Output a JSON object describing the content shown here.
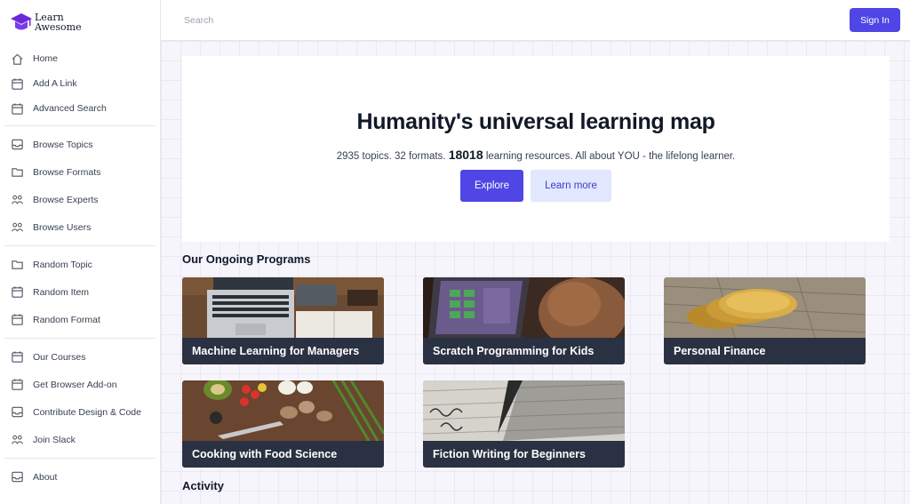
{
  "brand": {
    "line1": "Learn",
    "line2": "Awesome"
  },
  "search": {
    "placeholder": "Search"
  },
  "auth": {
    "sign_in": "Sign In"
  },
  "sidebar": {
    "groups": [
      [
        {
          "label": "Home",
          "icon": "home-icon"
        },
        {
          "label": "Add A Link",
          "icon": "calendar-icon"
        },
        {
          "label": "Advanced Search",
          "icon": "calendar-icon"
        }
      ],
      [
        {
          "label": "Browse Topics",
          "icon": "inbox-icon"
        },
        {
          "label": "Browse Formats",
          "icon": "folder-icon"
        },
        {
          "label": "Browse Experts",
          "icon": "users-icon"
        },
        {
          "label": "Browse Users",
          "icon": "users-icon"
        }
      ],
      [
        {
          "label": "Random Topic",
          "icon": "folder-icon"
        },
        {
          "label": "Random Item",
          "icon": "calendar-icon"
        },
        {
          "label": "Random Format",
          "icon": "calendar-icon"
        }
      ],
      [
        {
          "label": "Our Courses",
          "icon": "calendar-icon"
        },
        {
          "label": "Get Browser Add-on",
          "icon": "calendar-icon"
        },
        {
          "label": "Contribute Design & Code",
          "icon": "inbox-icon"
        },
        {
          "label": "Join Slack",
          "icon": "users-icon"
        }
      ],
      [
        {
          "label": "About",
          "icon": "inbox-icon"
        }
      ]
    ]
  },
  "hero": {
    "title": "Humanity's universal learning map",
    "sub_prefix": "2935 topics. 32 formats.",
    "resources_count": "18018",
    "sub_suffix": "learning resources. All about YOU - the lifelong learner.",
    "explore_label": "Explore",
    "learn_more_label": "Learn more"
  },
  "programs": {
    "title": "Our Ongoing Programs",
    "items": [
      {
        "label": "Machine Learning for Managers",
        "image": "laptop-desk-photo"
      },
      {
        "label": "Scratch Programming for Kids",
        "image": "tablet-photo"
      },
      {
        "label": "Personal Finance",
        "image": "gold-coins-photo"
      },
      {
        "label": "Cooking with Food Science",
        "image": "vegetables-photo"
      },
      {
        "label": "Fiction Writing for Beginners",
        "image": "fountain-pen-photo"
      }
    ]
  },
  "activity": {
    "title": "Activity"
  },
  "colors": {
    "accent": "#4f46e5",
    "accent_light": "#e0e7ff",
    "caption_bg": "#2a3142"
  }
}
